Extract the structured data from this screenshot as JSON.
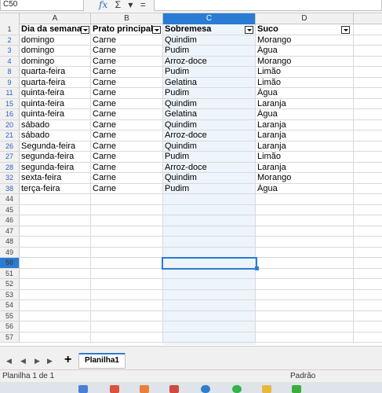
{
  "formula_bar": {
    "cell_ref": "C50",
    "fx_label": "fx",
    "sum_label": "Σ",
    "sum_dropdown": "▾",
    "equals_label": "="
  },
  "columns": [
    {
      "letter": "A",
      "selected": false
    },
    {
      "letter": "B",
      "selected": false
    },
    {
      "letter": "C",
      "selected": true
    },
    {
      "letter": "D",
      "selected": false
    }
  ],
  "header": {
    "row_number": "1",
    "cells": [
      "Dia da semana",
      "Prato principal",
      "Sobremesa",
      "Suco"
    ]
  },
  "rows": [
    {
      "n": "2",
      "cells": [
        "domingo",
        "Carne",
        "Quindim",
        "Morango"
      ]
    },
    {
      "n": "3",
      "cells": [
        "domingo",
        "Carne",
        "Pudim",
        "Água"
      ]
    },
    {
      "n": "4",
      "cells": [
        "domingo",
        "Carne",
        "Arroz-doce",
        "Morango"
      ]
    },
    {
      "n": "8",
      "cells": [
        "quarta-feira",
        "Carne",
        "Pudim",
        "Limão"
      ]
    },
    {
      "n": "9",
      "cells": [
        "quarta-feira",
        "Carne",
        "Gelatina",
        "Limão"
      ]
    },
    {
      "n": "11",
      "cells": [
        "quinta-feira",
        "Carne",
        "Pudim",
        "Água"
      ]
    },
    {
      "n": "15",
      "cells": [
        "quinta-feira",
        "Carne",
        "Quindim",
        "Laranja"
      ]
    },
    {
      "n": "16",
      "cells": [
        "quinta-feira",
        "Carne",
        "Gelatina",
        "Água"
      ]
    },
    {
      "n": "20",
      "cells": [
        "sábado",
        "Carne",
        "Quindim",
        "Laranja"
      ]
    },
    {
      "n": "21",
      "cells": [
        "sábado",
        "Carne",
        "Arroz-doce",
        "Laranja"
      ]
    },
    {
      "n": "26",
      "cells": [
        "Segunda-feira",
        "Carne",
        "Quindim",
        "Laranja"
      ]
    },
    {
      "n": "27",
      "cells": [
        "segunda-feira",
        "Carne",
        "Pudim",
        "Limão"
      ]
    },
    {
      "n": "28",
      "cells": [
        "segunda-feira",
        "Carne",
        "Arroz-doce",
        "Laranja"
      ]
    },
    {
      "n": "32",
      "cells": [
        "sexta-feira",
        "Carne",
        "Quindim",
        "Morango"
      ]
    },
    {
      "n": "38",
      "cells": [
        "terça-feira",
        "Carne",
        "Pudim",
        "Água"
      ]
    }
  ],
  "empty_rows": [
    "44",
    "45",
    "46",
    "47",
    "48",
    "49",
    "50",
    "51",
    "52",
    "53",
    "54",
    "55",
    "56",
    "57"
  ],
  "active_row": "50",
  "tabs": {
    "add_label": "+",
    "sheet_name": "Planilha1"
  },
  "status": {
    "sheet_info": "Planilha 1 de 1",
    "page_style": "Padrão"
  },
  "colors": {
    "selection": "#2a7bd4",
    "column_shade": "#eef4fb"
  }
}
